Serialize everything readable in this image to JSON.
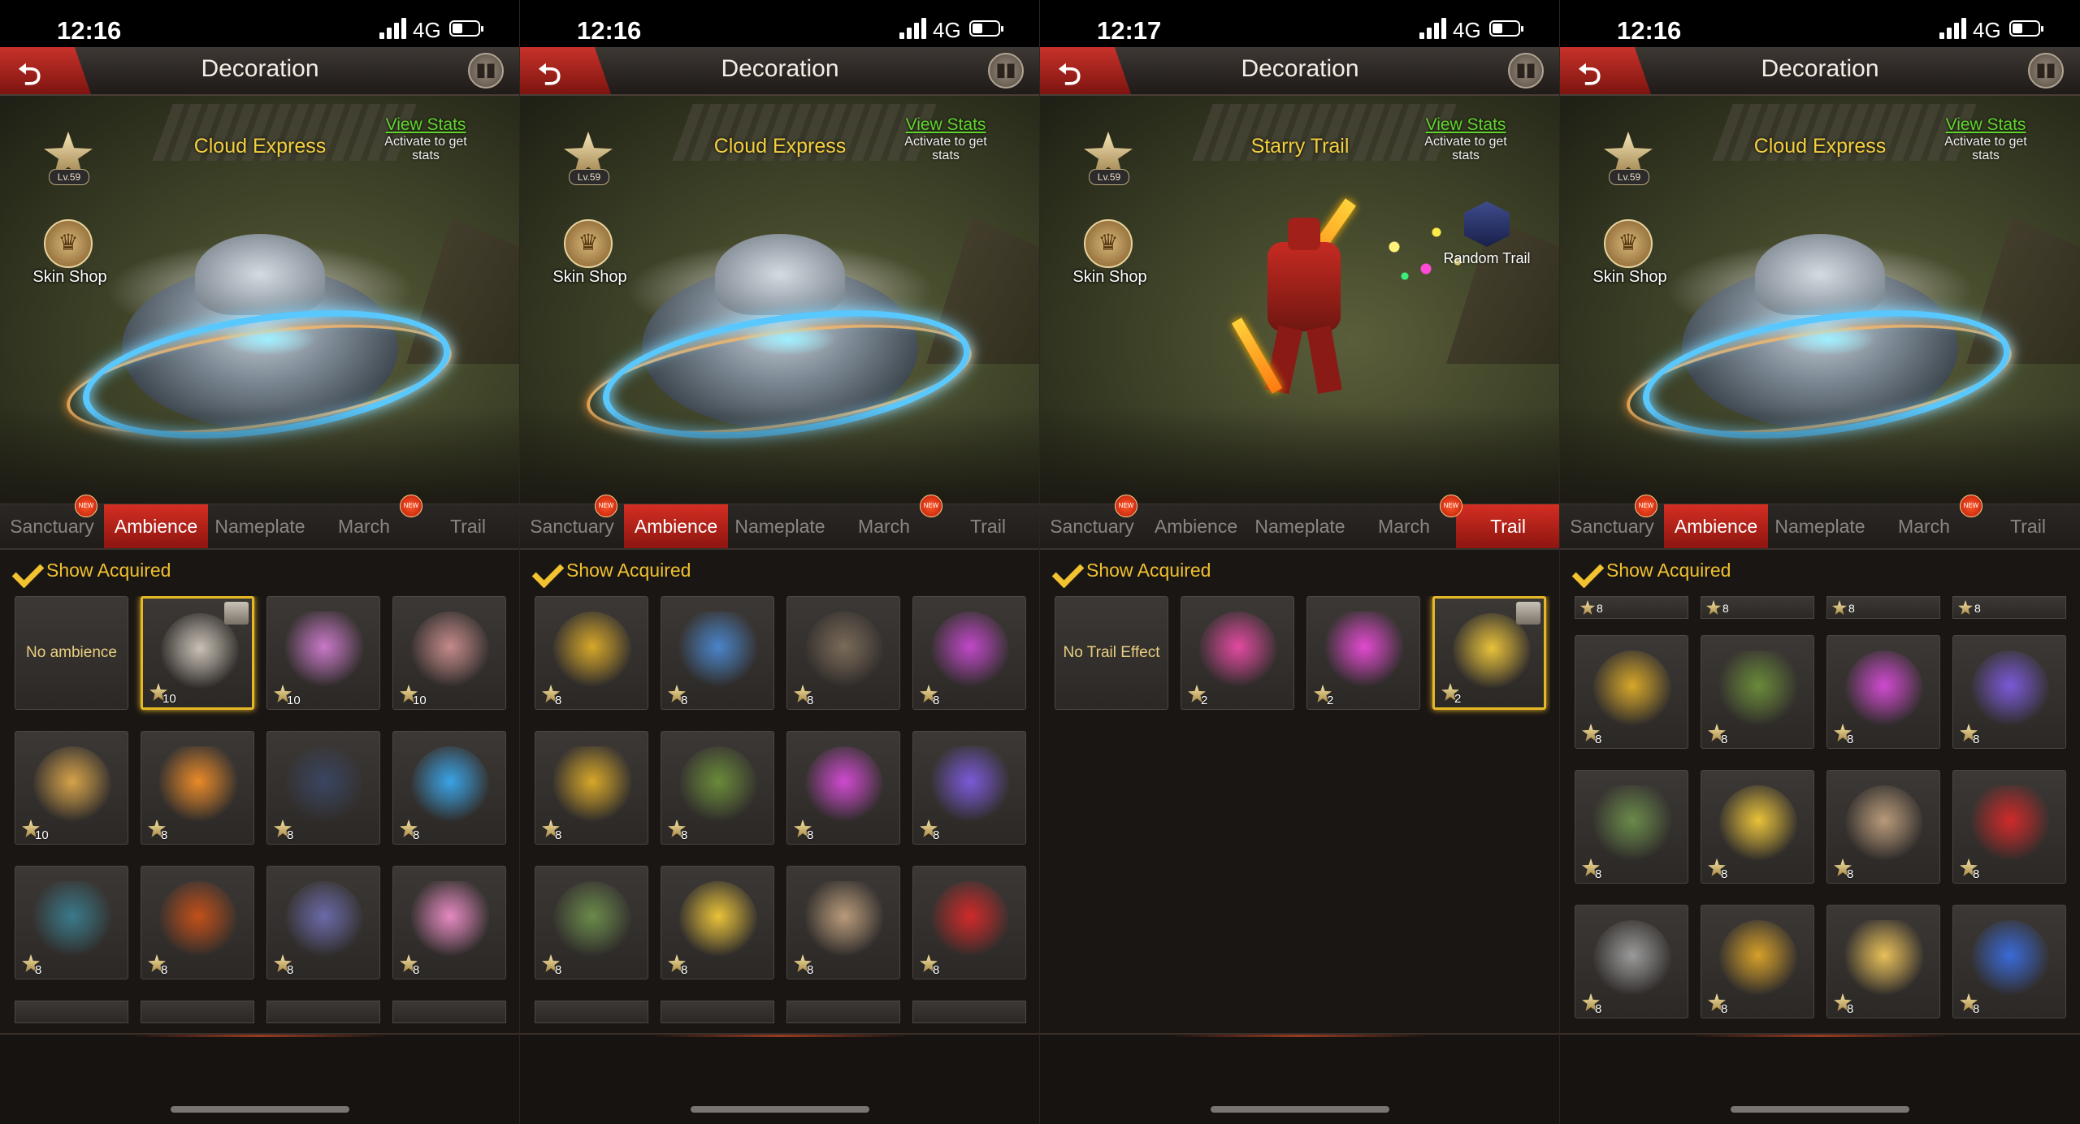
{
  "colors": {
    "accent_red": "#c62a20",
    "gold": "#f2c230",
    "link_green": "#61d32d",
    "title_yellow": "#f4cf3e"
  },
  "tabs_labels": [
    "Sanctuary",
    "Ambience",
    "Nameplate",
    "March",
    "Trail"
  ],
  "new_badge": "NEW",
  "panels": [
    {
      "status_time": "12:16",
      "network": "4G",
      "header_title": "Decoration",
      "decoration_name": "Cloud Express",
      "view_stats": "View Stats",
      "stats_note": "Activate to get stats",
      "level": "Lv.59",
      "skin_shop": "Skin Shop",
      "active_tab": 1,
      "show_acquired": "Show Acquired",
      "grid_start_label": "No ambience",
      "items": [
        {
          "count": "10",
          "color": "#c9c1b6",
          "sel": true,
          "lock": true
        },
        {
          "count": "10",
          "color": "#c878c8"
        },
        {
          "count": "10",
          "color": "#c48a8a"
        },
        {
          "count": "10",
          "color": "#d6a34a"
        },
        {
          "count": "8",
          "color": "#e98a2a"
        },
        {
          "count": "8",
          "color": "#3a4560"
        },
        {
          "count": "8",
          "color": "#3aa3e5"
        },
        {
          "count": "8",
          "color": "#3a7a8a"
        },
        {
          "count": "8",
          "color": "#c2501a"
        },
        {
          "count": "8",
          "color": "#6a6aa8"
        },
        {
          "count": "8",
          "color": "#e68ac2"
        }
      ]
    },
    {
      "status_time": "12:16",
      "network": "4G",
      "header_title": "Decoration",
      "decoration_name": "Cloud Express",
      "view_stats": "View Stats",
      "stats_note": "Activate to get stats",
      "level": "Lv.59",
      "skin_shop": "Skin Shop",
      "active_tab": 1,
      "show_acquired": "Show Acquired",
      "items": [
        {
          "count": "8",
          "color": "#d6a72a"
        },
        {
          "count": "8",
          "color": "#4a84c8"
        },
        {
          "count": "8",
          "color": "#7a6a58"
        },
        {
          "count": "8",
          "color": "#c048c8"
        },
        {
          "count": "8",
          "color": "#d6a72a"
        },
        {
          "count": "8",
          "color": "#6a8a3a"
        },
        {
          "count": "8",
          "color": "#d04ad0"
        },
        {
          "count": "8",
          "color": "#7a5ad8"
        },
        {
          "count": "8",
          "color": "#6a8a4a"
        },
        {
          "count": "8",
          "color": "#e8c23a"
        },
        {
          "count": "8",
          "color": "#b89a7a"
        },
        {
          "count": "8",
          "color": "#d02a2a"
        }
      ]
    },
    {
      "status_time": "12:17",
      "network": "4G",
      "header_title": "Decoration",
      "decoration_name": "Starry Trail",
      "view_stats": "View Stats",
      "stats_note": "Activate to get stats",
      "level": "Lv.59",
      "skin_shop": "Skin Shop",
      "random_trail": "Random Trail",
      "active_tab": 4,
      "show_acquired": "Show Acquired",
      "grid_start_label": "No Trail Effect",
      "items": [
        {
          "count": "2",
          "color": "#e24aa0"
        },
        {
          "count": "2",
          "color": "#e24ad0"
        },
        {
          "count": "2",
          "color": "#e8c23a",
          "sel": true,
          "lock": true
        }
      ]
    },
    {
      "status_time": "12:16",
      "network": "4G",
      "header_title": "Decoration",
      "decoration_name": "Cloud Express",
      "view_stats": "View Stats",
      "stats_note": "Activate to get stats",
      "level": "Lv.59",
      "skin_shop": "Skin Shop",
      "active_tab": 1,
      "show_acquired": "Show Acquired",
      "top_partial_counts": [
        "8",
        "8",
        "8",
        "8"
      ],
      "items": [
        {
          "count": "8",
          "color": "#d6a72a"
        },
        {
          "count": "8",
          "color": "#6a8a3a"
        },
        {
          "count": "8",
          "color": "#d04ad0"
        },
        {
          "count": "8",
          "color": "#7a5ad8"
        },
        {
          "count": "8",
          "color": "#6a8a4a"
        },
        {
          "count": "8",
          "color": "#e8c23a"
        },
        {
          "count": "8",
          "color": "#b89a7a"
        },
        {
          "count": "8",
          "color": "#d02a2a"
        },
        {
          "count": "8",
          "color": "#9a9a9a"
        },
        {
          "count": "8",
          "color": "#d6a02a"
        },
        {
          "count": "8",
          "color": "#e8c05a"
        },
        {
          "count": "8",
          "color": "#3a6ad8"
        }
      ]
    }
  ]
}
